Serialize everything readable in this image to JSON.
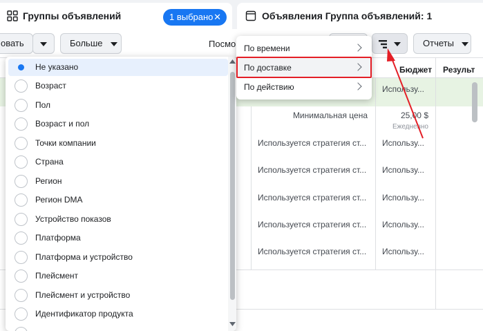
{
  "header": {
    "left_title": "Группы объявлений",
    "selected_pill": "1 выбрано",
    "right_title": "Объявления Группа объявлений: 1"
  },
  "toolbar": {
    "edit_partial": "овать",
    "more_label": "Больше",
    "view_partial": "Посмо",
    "reports_label": "Отчеты"
  },
  "table": {
    "col_budget": "Бюджет",
    "col_results": "Результ",
    "rows": [
      {
        "strategy": "",
        "budget": "Использу..."
      },
      {
        "strategy": "Минимальная цена",
        "budget": "25,00 $",
        "budget_sub": "Ежедневно"
      },
      {
        "strategy": "Используется стратегия ст...",
        "budget": "Использу..."
      },
      {
        "strategy": "Используется стратегия ст...",
        "budget": "Использу..."
      },
      {
        "strategy": "Используется стратегия ст...",
        "budget": "Использу..."
      },
      {
        "strategy": "Используется стратегия ст...",
        "budget": "Использу..."
      },
      {
        "strategy": "Используется стратегия ст...",
        "budget": "Использу..."
      }
    ]
  },
  "breakdown_options": [
    {
      "label": "Не указано",
      "selected": true
    },
    {
      "label": "Возраст"
    },
    {
      "label": "Пол"
    },
    {
      "label": "Возраст и пол"
    },
    {
      "label": "Точки компании"
    },
    {
      "label": "Страна"
    },
    {
      "label": "Регион"
    },
    {
      "label": "Регион DMA"
    },
    {
      "label": "Устройство показов"
    },
    {
      "label": "Платформа"
    },
    {
      "label": "Платформа и устройство"
    },
    {
      "label": "Плейсмент"
    },
    {
      "label": "Плейсмент и устройство"
    },
    {
      "label": "Идентификатор продукта"
    }
  ],
  "breakdown_menu": [
    {
      "label": "По времени"
    },
    {
      "label": "По доставке",
      "highlighted": true
    },
    {
      "label": "По действию"
    }
  ],
  "colors": {
    "accent": "#1877f2",
    "annotation_red": "#e41e26",
    "selected_row": "#e7f3e3"
  }
}
